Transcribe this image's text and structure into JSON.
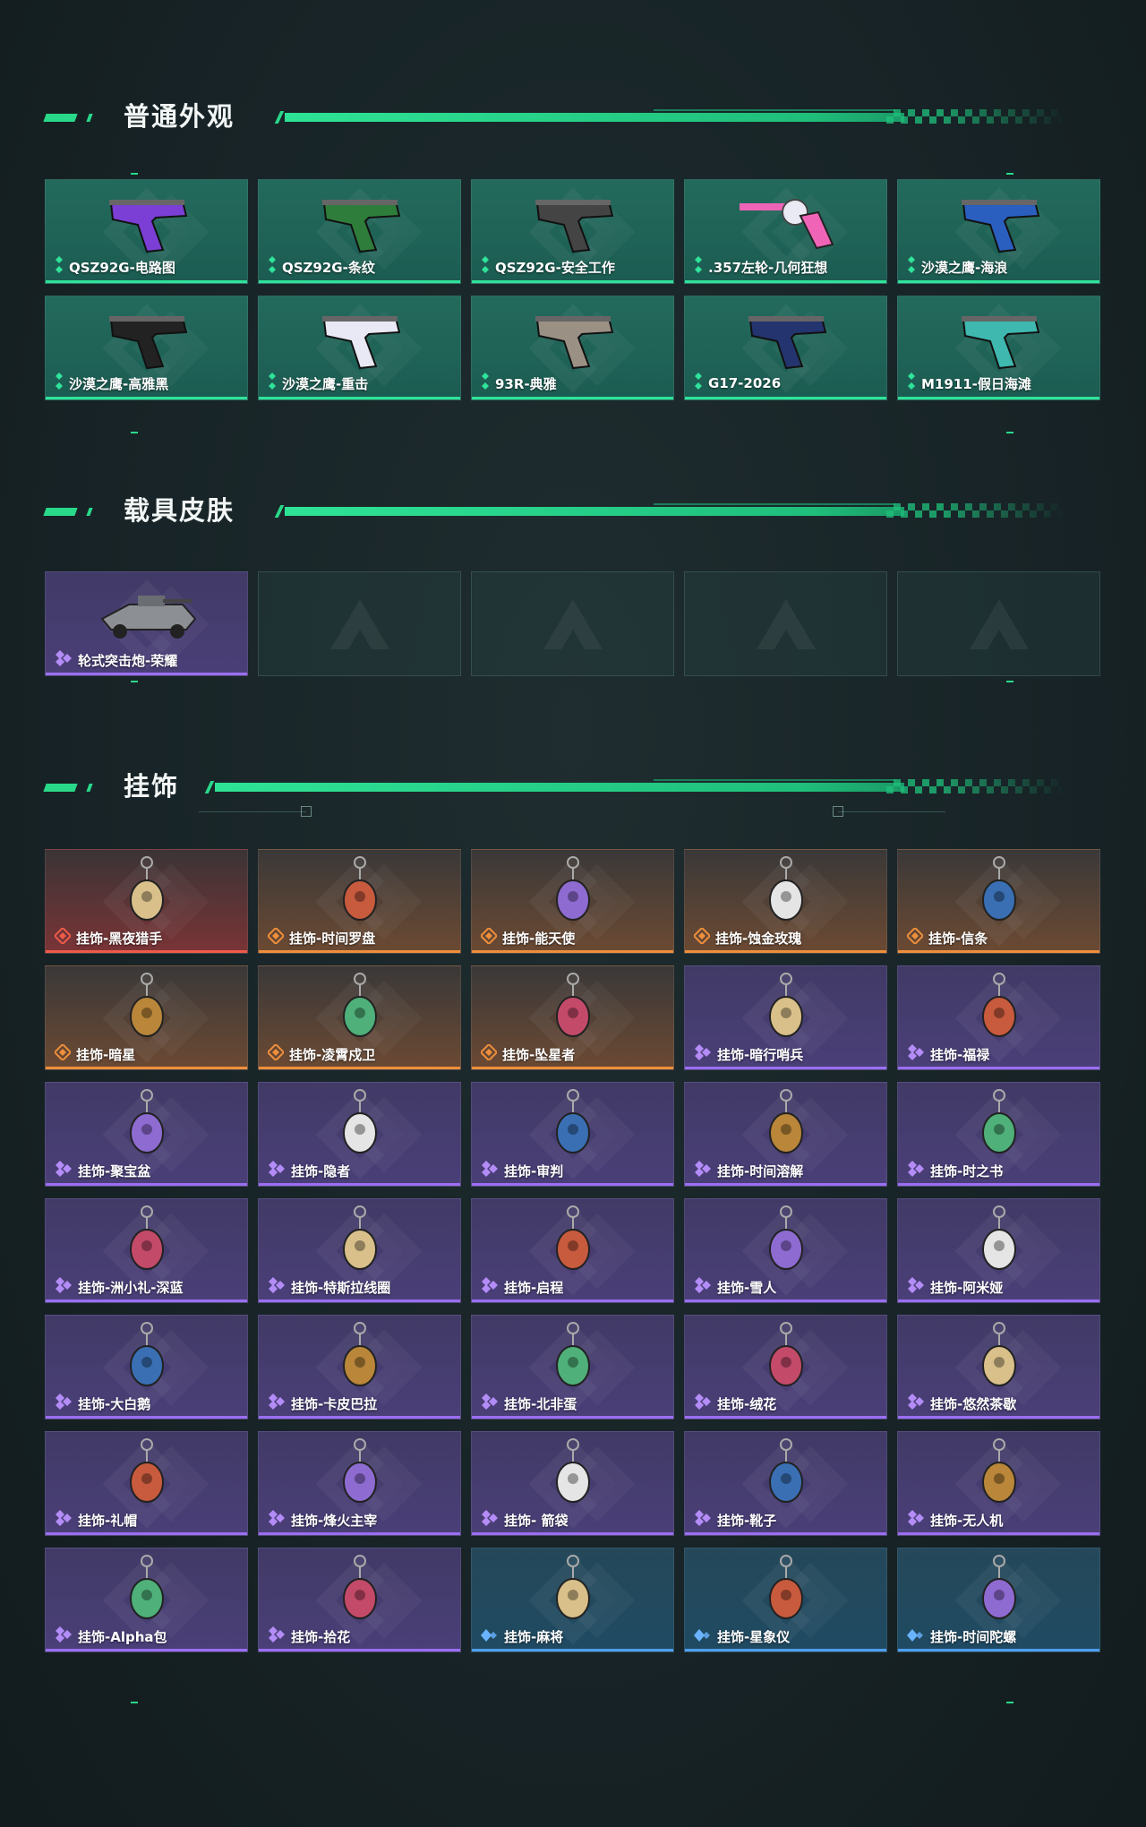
{
  "sections": [
    {
      "title": "普通外观",
      "items": [
        {
          "label": "QSZ92G-电路图",
          "rarity": "green",
          "icon": "pistol-icon"
        },
        {
          "label": "QSZ92G-条纹",
          "rarity": "green",
          "icon": "pistol-icon"
        },
        {
          "label": "QSZ92G-安全工作",
          "rarity": "green",
          "icon": "pistol-icon"
        },
        {
          "label": ".357左轮-几何狂想",
          "rarity": "green",
          "icon": "revolver-icon"
        },
        {
          "label": "沙漠之鹰-海浪",
          "rarity": "green",
          "icon": "pistol-icon"
        },
        {
          "label": "沙漠之鹰-高雅黑",
          "rarity": "green",
          "icon": "pistol-icon"
        },
        {
          "label": "沙漠之鹰-重击",
          "rarity": "green",
          "icon": "pistol-icon"
        },
        {
          "label": "93R-典雅",
          "rarity": "green",
          "icon": "pistol-icon"
        },
        {
          "label": "G17-2026",
          "rarity": "green",
          "icon": "pistol-icon"
        },
        {
          "label": "M1911-假日海滩",
          "rarity": "green",
          "icon": "pistol-icon"
        }
      ]
    },
    {
      "title": "载具皮肤",
      "items": [
        {
          "label": "轮式突击炮-荣耀",
          "rarity": "purple",
          "icon": "vehicle-icon"
        },
        {
          "label": "",
          "rarity": "empty",
          "icon": "placeholder-logo-icon"
        },
        {
          "label": "",
          "rarity": "empty",
          "icon": "placeholder-logo-icon"
        },
        {
          "label": "",
          "rarity": "empty",
          "icon": "placeholder-logo-icon"
        },
        {
          "label": "",
          "rarity": "empty",
          "icon": "placeholder-logo-icon"
        }
      ]
    },
    {
      "title": "挂饰",
      "items": [
        {
          "label": "挂饰-黑夜猎手",
          "rarity": "red",
          "icon": "charm-icon"
        },
        {
          "label": "挂饰-时间罗盘",
          "rarity": "orange",
          "icon": "charm-icon"
        },
        {
          "label": "挂饰-能天使",
          "rarity": "orange",
          "icon": "charm-icon"
        },
        {
          "label": "挂饰-蚀金玫瑰",
          "rarity": "orange",
          "icon": "charm-icon"
        },
        {
          "label": "挂饰-信条",
          "rarity": "orange",
          "icon": "charm-icon"
        },
        {
          "label": "挂饰-暗星",
          "rarity": "orange",
          "icon": "charm-icon"
        },
        {
          "label": "挂饰-凌霄戍卫",
          "rarity": "orange",
          "icon": "charm-icon"
        },
        {
          "label": "挂饰-坠星者",
          "rarity": "orange",
          "icon": "charm-icon"
        },
        {
          "label": "挂饰-暗行哨兵",
          "rarity": "purple",
          "icon": "charm-icon"
        },
        {
          "label": "挂饰-福禄",
          "rarity": "purple",
          "icon": "charm-icon"
        },
        {
          "label": "挂饰-聚宝盆",
          "rarity": "purple",
          "icon": "charm-icon"
        },
        {
          "label": "挂饰-隐者",
          "rarity": "purple",
          "icon": "charm-icon"
        },
        {
          "label": "挂饰-审判",
          "rarity": "purple",
          "icon": "charm-icon"
        },
        {
          "label": "挂饰-时间溶解",
          "rarity": "purple",
          "icon": "charm-icon"
        },
        {
          "label": "挂饰-时之书",
          "rarity": "purple",
          "icon": "charm-icon"
        },
        {
          "label": "挂饰-洲小礼-深蓝",
          "rarity": "purple",
          "icon": "charm-icon"
        },
        {
          "label": "挂饰-特斯拉线圈",
          "rarity": "purple",
          "icon": "charm-icon"
        },
        {
          "label": "挂饰-启程",
          "rarity": "purple",
          "icon": "charm-icon"
        },
        {
          "label": "挂饰-雪人",
          "rarity": "purple",
          "icon": "charm-icon"
        },
        {
          "label": "挂饰-阿米娅",
          "rarity": "purple",
          "icon": "charm-icon"
        },
        {
          "label": "挂饰-大白鹅",
          "rarity": "purple",
          "icon": "charm-icon"
        },
        {
          "label": "挂饰-卡皮巴拉",
          "rarity": "purple",
          "icon": "charm-icon"
        },
        {
          "label": "挂饰-北非蛋",
          "rarity": "purple",
          "icon": "charm-icon"
        },
        {
          "label": "挂饰-绒花",
          "rarity": "purple",
          "icon": "charm-icon"
        },
        {
          "label": "挂饰-悠然茶歇",
          "rarity": "purple",
          "icon": "charm-icon"
        },
        {
          "label": "挂饰-礼帽",
          "rarity": "purple",
          "icon": "charm-icon"
        },
        {
          "label": "挂饰-烽火主宰",
          "rarity": "purple",
          "icon": "charm-icon"
        },
        {
          "label": "挂饰- 箭袋",
          "rarity": "purple",
          "icon": "charm-icon"
        },
        {
          "label": "挂饰-靴子",
          "rarity": "purple",
          "icon": "charm-icon"
        },
        {
          "label": "挂饰-无人机",
          "rarity": "purple",
          "icon": "charm-icon"
        },
        {
          "label": "挂饰-Alpha包",
          "rarity": "purple",
          "icon": "charm-icon"
        },
        {
          "label": "挂饰-拾花",
          "rarity": "purple",
          "icon": "charm-icon"
        },
        {
          "label": "挂饰-麻将",
          "rarity": "blue",
          "icon": "charm-icon"
        },
        {
          "label": "挂饰-星象仪",
          "rarity": "blue",
          "icon": "charm-icon"
        },
        {
          "label": "挂饰-时间陀螺",
          "rarity": "blue",
          "icon": "charm-icon"
        }
      ]
    }
  ],
  "colors": {
    "accent": "#29d98a",
    "green_line": "#2fe39a",
    "purple_line": "#9b6ef2",
    "orange_line": "#ef8f3b",
    "red_line": "#ef5a4a",
    "blue_line": "#4d9ff0"
  }
}
